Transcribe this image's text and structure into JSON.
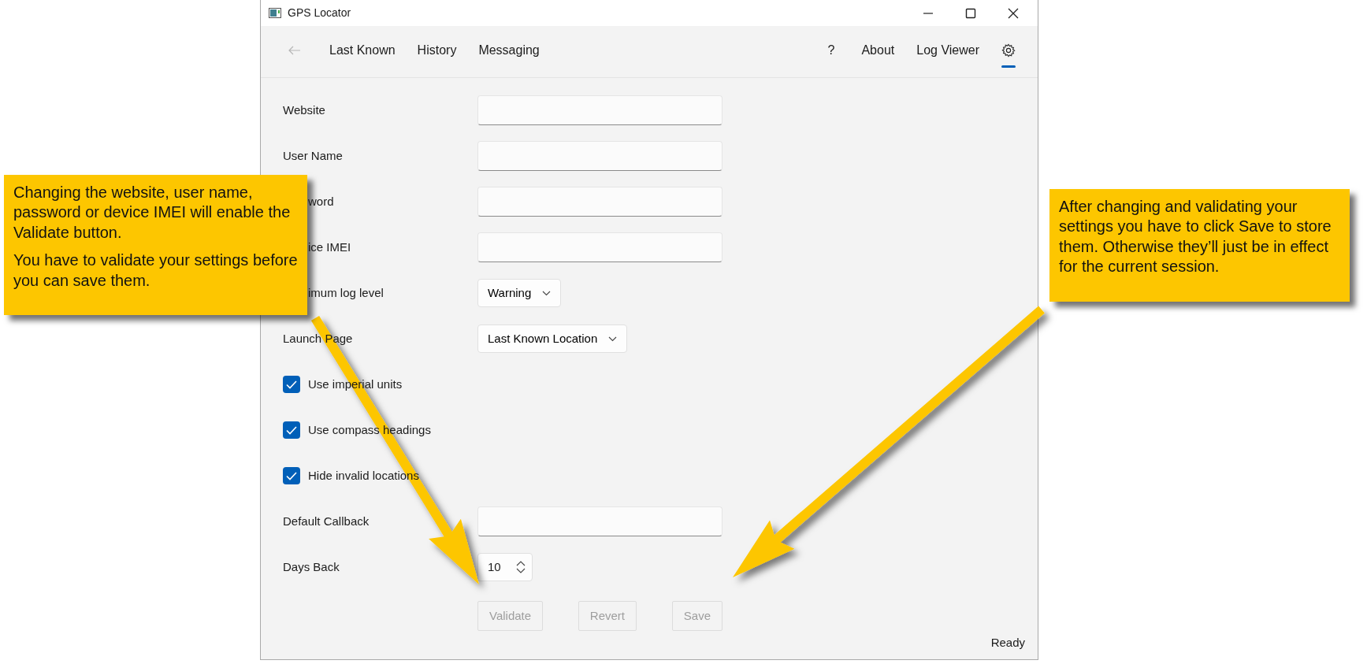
{
  "window": {
    "title": "GPS Locator"
  },
  "nav": {
    "back": {
      "disabled": true
    },
    "left_items": [
      {
        "label": "Last Known",
        "selected": false
      },
      {
        "label": "History",
        "selected": false
      },
      {
        "label": "Messaging",
        "selected": false
      }
    ],
    "right_items": [
      {
        "kind": "help",
        "label": "?",
        "selected": false
      },
      {
        "kind": "text",
        "label": "About",
        "selected": false
      },
      {
        "kind": "text",
        "label": "Log Viewer",
        "selected": false
      },
      {
        "kind": "settings",
        "selected": true
      }
    ]
  },
  "form": {
    "rows": [
      {
        "kind": "text",
        "label": "Website"
      },
      {
        "kind": "text",
        "label": "User Name"
      },
      {
        "kind": "text",
        "label": "word"
      },
      {
        "kind": "text",
        "label": "ice IMEI"
      },
      {
        "kind": "select",
        "label": "imum log level",
        "value": "Warning"
      },
      {
        "kind": "select",
        "label": "Launch Page",
        "value": "Last Known Location"
      },
      {
        "kind": "checkbox",
        "label": "Use imperial units",
        "checked": true
      },
      {
        "kind": "checkbox",
        "label": "Use compass headings",
        "checked": true
      },
      {
        "kind": "checkbox",
        "label": "Hide invalid locations",
        "checked": true
      },
      {
        "kind": "text",
        "label": "Default Callback"
      },
      {
        "kind": "number",
        "label": "Days Back",
        "value": "10"
      }
    ]
  },
  "buttons": [
    {
      "label": "Validate",
      "disabled": true
    },
    {
      "label": "Revert",
      "disabled": true
    },
    {
      "label": "Save",
      "disabled": true
    }
  ],
  "status_bar": "Ready",
  "callouts": [
    {
      "paragraphs": [
        "Changing the website, user name, password or device IMEI will enable the Validate button.",
        "You have to validate your settings before you can save them."
      ]
    },
    {
      "paragraphs": [
        "After changing and validating your settings you have to click Save to store them. Otherwise they’ll just be in effect for the current session."
      ]
    }
  ]
}
